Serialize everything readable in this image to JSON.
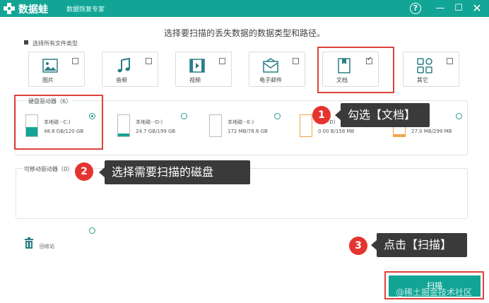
{
  "app": {
    "name": "数据蛙",
    "subtitle": "数据恢复专家"
  },
  "window_controls": {
    "help": "?",
    "minimize": "—",
    "maximize": "☐",
    "close": "✕"
  },
  "headline": "选择要扫描的丢失数据的数据类型和路径。",
  "select_all": "选择所有文件类型",
  "file_types": [
    {
      "label": "图片",
      "icon": "image-icon",
      "checked": false
    },
    {
      "label": "音频",
      "icon": "music-icon",
      "checked": false
    },
    {
      "label": "视频",
      "icon": "video-icon",
      "checked": false
    },
    {
      "label": "电子邮件",
      "icon": "email-icon",
      "checked": false
    },
    {
      "label": "文档",
      "icon": "document-icon",
      "checked": true
    },
    {
      "label": "其它",
      "icon": "other-icon",
      "checked": false
    }
  ],
  "hard_drives": {
    "title": "硬盘驱动器（6）",
    "items": [
      {
        "name": "本地磁···C:)",
        "size": "48.8 GB/120 GB",
        "selected": true
      },
      {
        "name": "本地磁···D:)",
        "size": "24.7 GB/199 GB",
        "selected": false
      },
      {
        "name": "本地磁···E:)",
        "size": "172 MB/78.8 GB",
        "selected": false
      },
      {
        "name": "(丢···D)",
        "size": "0.00  B/158 MB",
        "selected": false
      },
      {
        "name": "",
        "size": "27.0 MB/299 MB",
        "selected": false
      }
    ]
  },
  "removable": {
    "title": "可移动驱动器（0）"
  },
  "recycle_bin": "回收站",
  "scan_button": "扫描",
  "watermark": "@稀土掘金技术社区",
  "callouts": [
    {
      "num": "1",
      "text": "勾选【文档】"
    },
    {
      "num": "2",
      "text": "选择需要扫描的磁盘"
    },
    {
      "num": "3",
      "text": "点击【扫描】"
    }
  ],
  "colors": {
    "brand": "#12a596",
    "highlight": "#e0403b",
    "callout_bg": "#3a3a3a",
    "badge": "#e5342f"
  }
}
